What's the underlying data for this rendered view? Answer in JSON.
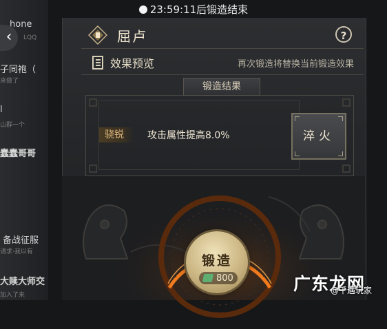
{
  "timer": {
    "text": "23:59:11后锻造结束"
  },
  "header": {
    "title": "屈卢",
    "help_label": "?"
  },
  "preview": {
    "label": "效果预览",
    "note": "再次锻造将替换当前锻造效果"
  },
  "result": {
    "tab_label": "锻造结果",
    "tag": "骁锐",
    "effect": "攻击属性提高8.0%",
    "quench_label": "淬火"
  },
  "forge": {
    "label": "锻造",
    "cost": "800",
    "cost_icon": "jade-currency-icon"
  },
  "background_chat": {
    "lines": [
      "hone",
      "LQQ",
      "子同袍（",
      "来做了",
      "l",
      "山群一个",
      "蠢蠢哥哥",
      "备战征服",
      "请求·我以有",
      "大赎大师交",
      "加入了来"
    ]
  },
  "watermark": {
    "brand": "广东龙网",
    "sub": "@千遇玩家"
  },
  "colors": {
    "accent_gold": "#d9b37a",
    "ring_orange": "#f07a1e",
    "panel": "#2a2c2f"
  }
}
